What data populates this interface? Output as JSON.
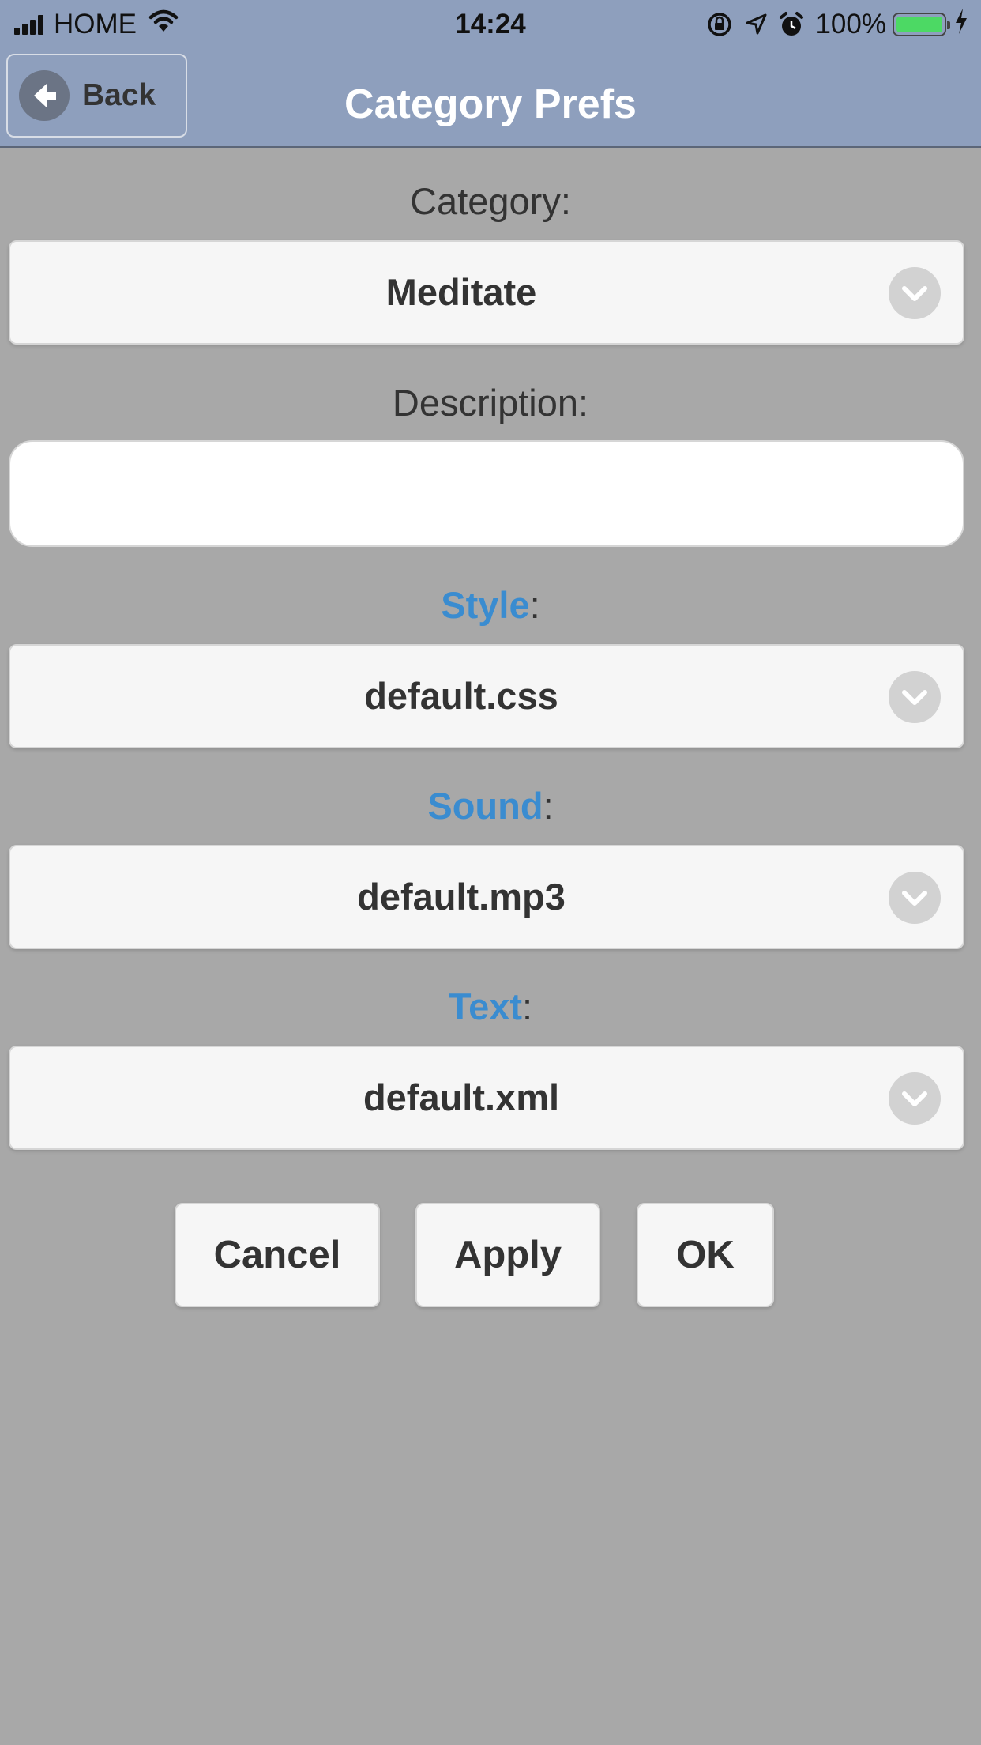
{
  "status_bar": {
    "carrier": "HOME",
    "time": "14:24",
    "battery_percent": "100%",
    "battery_level": 1.0,
    "icons": [
      "signal-icon",
      "wifi-icon",
      "rotation-lock-icon",
      "location-icon",
      "alarm-icon",
      "battery-icon",
      "charging-icon"
    ]
  },
  "header": {
    "back_label": "Back",
    "title": "Category Prefs"
  },
  "form": {
    "category": {
      "label": "Category:",
      "value": "Meditate"
    },
    "description": {
      "label": "Description:",
      "value": "",
      "placeholder": ""
    },
    "style": {
      "link_text": "Style",
      "suffix": ":",
      "value": "default.css"
    },
    "sound": {
      "link_text": "Sound",
      "suffix": ":",
      "value": "default.mp3"
    },
    "text": {
      "link_text": "Text",
      "suffix": ":",
      "value": "default.xml"
    }
  },
  "buttons": {
    "cancel": "Cancel",
    "apply": "Apply",
    "ok": "OK"
  },
  "colors": {
    "header_bg": "#8e9fbd",
    "page_bg": "#a8a8a8",
    "link": "#3a8cd0",
    "battery": "#4cd964"
  }
}
